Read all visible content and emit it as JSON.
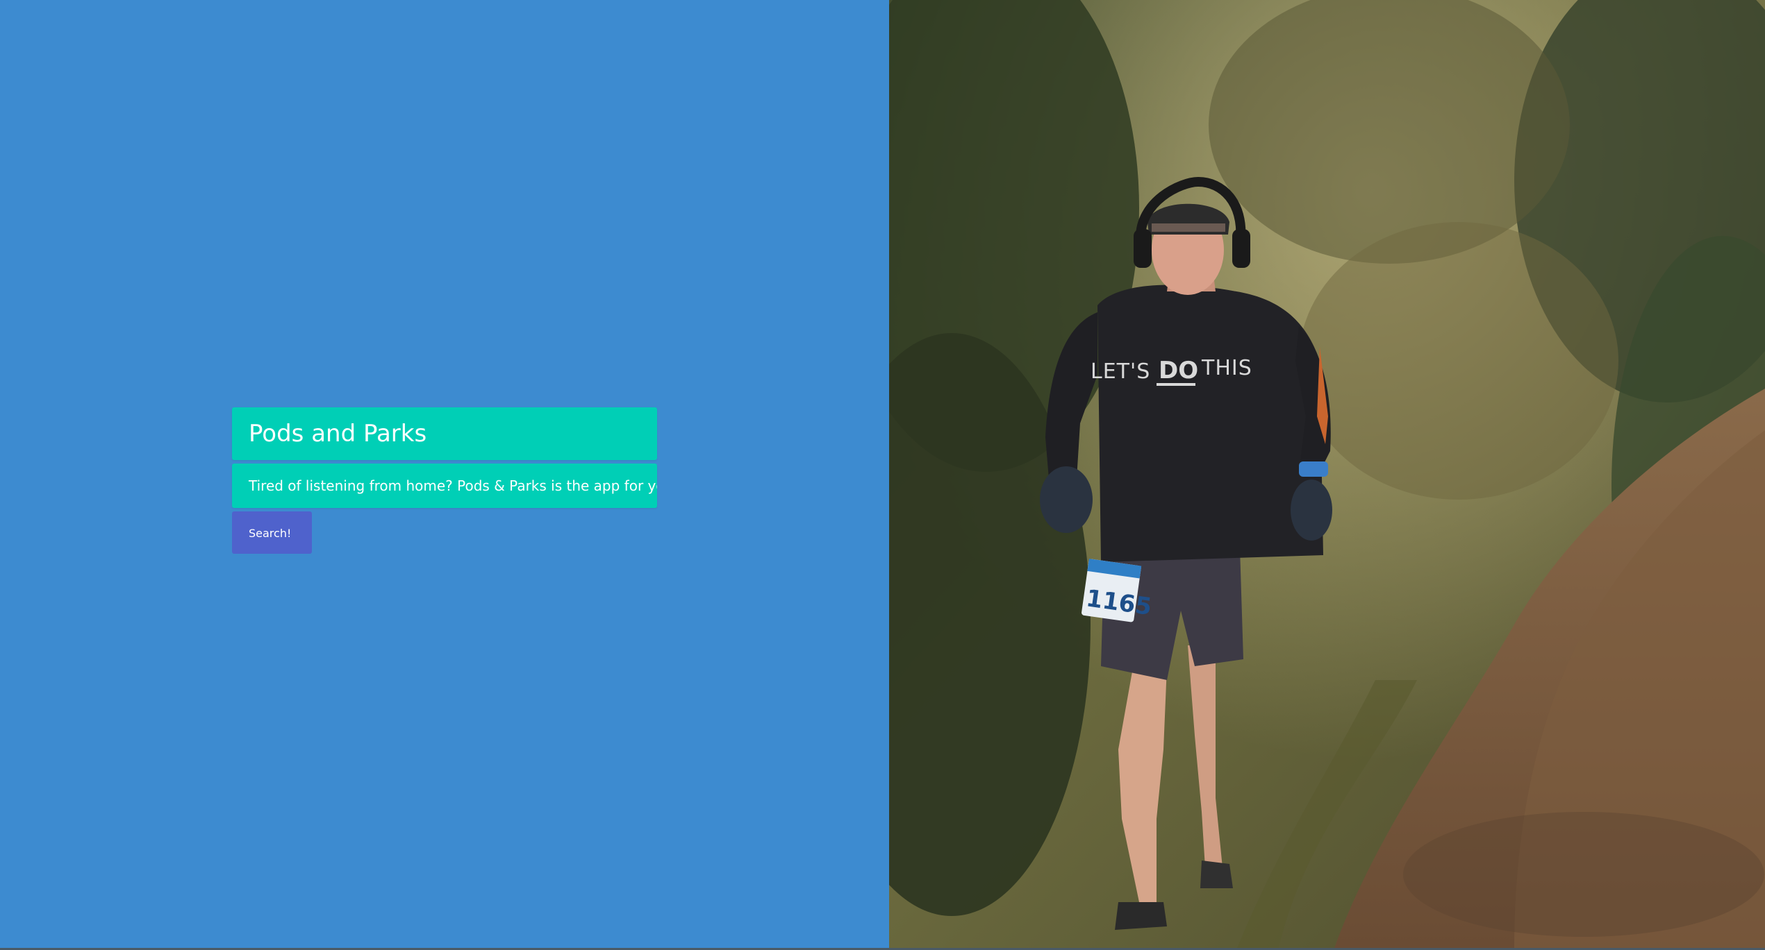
{
  "hero": {
    "title": "Pods and Parks",
    "subtitle": "Tired of listening from home? Pods & Parks is the app for you!",
    "search_label": "Search!"
  },
  "photo": {
    "subject": "trail-runner",
    "shirt_text": "LET'S DO THIS",
    "bib_number": "1165"
  },
  "colors": {
    "left_background": "#3d8bd0",
    "card_teal": "#00cfb6",
    "button_indigo": "#4f62cc"
  }
}
